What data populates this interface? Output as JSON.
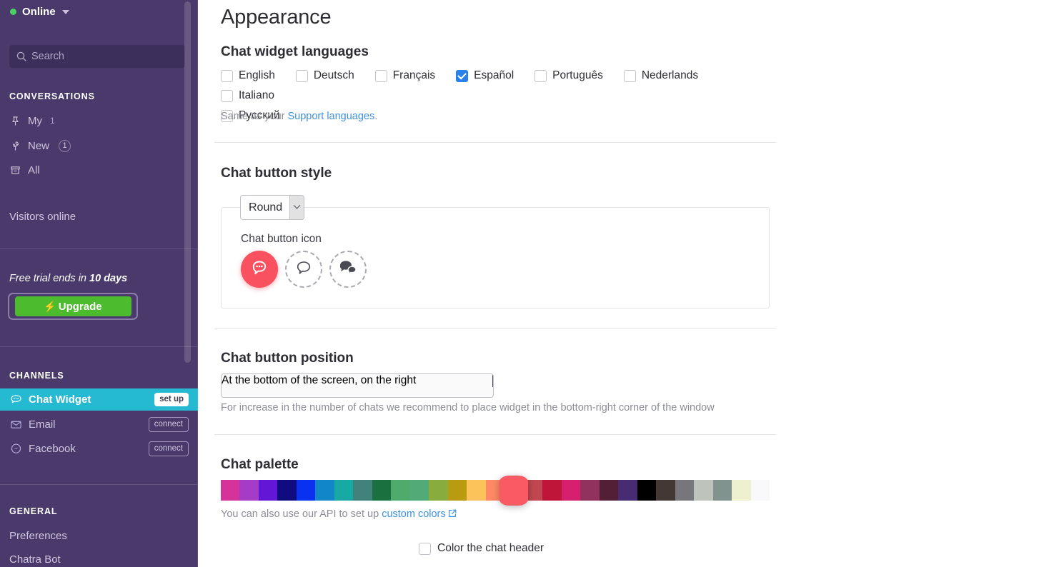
{
  "sidebar": {
    "status": {
      "label": "Online",
      "dot_color": "#4ad163",
      "icon": "caret-down-icon"
    },
    "search": {
      "placeholder": "Search",
      "icon": "search-icon"
    },
    "conversations": {
      "title": "CONVERSATIONS",
      "items": [
        {
          "label": "My",
          "icon": "pin-icon",
          "count": "1",
          "badge": false
        },
        {
          "label": "New",
          "icon": "sprout-icon",
          "count": "1",
          "badge": true
        },
        {
          "label": "All",
          "icon": "archive-icon",
          "count": "",
          "badge": false
        }
      ]
    },
    "visitors": {
      "label": "Visitors online"
    },
    "trial": {
      "prefix": "Free trial ends in ",
      "days": "10 days",
      "upgrade_label": "Upgrade",
      "upgrade_icon": "bolt-icon",
      "button_color": "#4cbb2e"
    },
    "channels": {
      "title": "CHANNELS",
      "items": [
        {
          "label": "Chat Widget",
          "icon": "chat-bubble-icon",
          "action": "set up",
          "active": true
        },
        {
          "label": "Email",
          "icon": "envelope-icon",
          "action": "connect",
          "active": false
        },
        {
          "label": "Facebook",
          "icon": "messenger-icon",
          "action": "connect",
          "active": false
        }
      ],
      "active_color": "#26b9d2"
    },
    "general": {
      "title": "GENERAL",
      "items": [
        {
          "label": "Preferences"
        },
        {
          "label": "Chatra Bot"
        }
      ]
    }
  },
  "main": {
    "page_title": "Appearance",
    "languages": {
      "heading": "Chat widget languages",
      "items": [
        {
          "label": "English",
          "checked": false
        },
        {
          "label": "Deutsch",
          "checked": false
        },
        {
          "label": "Français",
          "checked": false
        },
        {
          "label": "Español",
          "checked": true
        },
        {
          "label": "Português",
          "checked": false
        },
        {
          "label": "Nederlands",
          "checked": false
        },
        {
          "label": "Italiano",
          "checked": false
        },
        {
          "label": "Русский",
          "checked": false
        }
      ],
      "note_prefix": "Same as your ",
      "note_link": "Support languages",
      "note_suffix": ".",
      "checked_color": "#2a81ea"
    },
    "button_style": {
      "heading": "Chat button style",
      "select_value": "Round",
      "icon_label": "Chat button icon",
      "icons": [
        {
          "name": "bubble-dots-icon",
          "selected": true
        },
        {
          "name": "bubble-outline-icon",
          "selected": false
        },
        {
          "name": "two-bubbles-icon",
          "selected": false
        }
      ],
      "selected_color": "#f9515f"
    },
    "button_position": {
      "heading": "Chat button position",
      "select_value": "At the bottom of the screen, on the right",
      "note": "For increase in the number of chats we recommend to place widget in the bottom-right corner of the window"
    },
    "palette": {
      "heading": "Chat palette",
      "selected_index": 15,
      "selected_color": "#fa5a64",
      "swatches": [
        "#d6339a",
        "#a63bc8",
        "#6317d6",
        "#100b7e",
        "#0a31ef",
        "#1186c9",
        "#17a9a4",
        "#41827c",
        "#1b7040",
        "#4eab6c",
        "#52ab77",
        "#88ad3c",
        "#b99b10",
        "#fcc35b",
        "#fd8a64",
        "#fa5a64",
        "#c0474f",
        "#bf1539",
        "#d61f6e",
        "#91325e",
        "#531f37",
        "#472b73",
        "#000000",
        "#433834",
        "#77767a",
        "#bec3bb",
        "#81938f",
        "#eff0cf",
        "#f9f9fc"
      ],
      "note_prefix": "You can also use our API to set up ",
      "note_link": "custom colors",
      "link_icon": "external-link-icon"
    },
    "header_color_option": {
      "label": "Color the chat header",
      "checked": false
    }
  }
}
